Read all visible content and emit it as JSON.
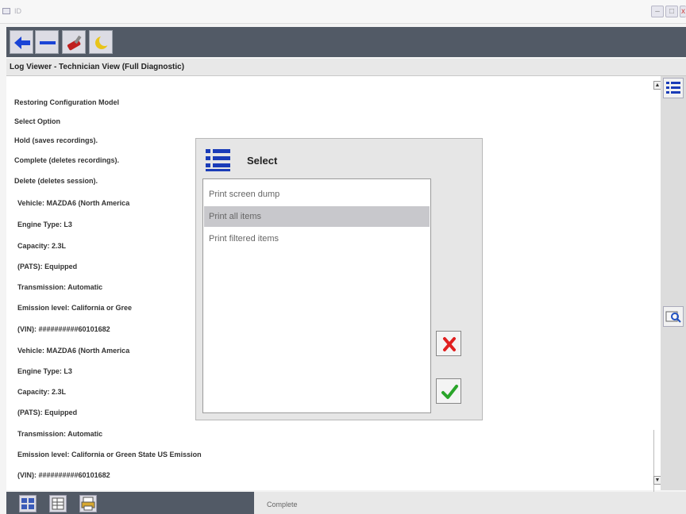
{
  "window": {
    "title": "ID"
  },
  "panel": {
    "title": "Log Viewer - Technician View (Full Diagnostic)"
  },
  "log_lines": [
    "Restoring Configuration Model",
    "Select Option",
    "Hold (saves recordings).",
    "Complete (deletes recordings).",
    "Delete (deletes session).",
    "Vehicle:  MAZDA6 (North America",
    "Engine Type:  L3",
    "Capacity:  2.3L",
    "(PATS):  Equipped",
    "Transmission:  Automatic",
    "Emission level:  California or Gree",
    "(VIN):  ##########60101682",
    "Vehicle:  MAZDA6 (North America",
    "Engine Type:  L3",
    "Capacity:  2.3L",
    "(PATS):  Equipped",
    "Transmission:  Automatic",
    "Emission level:  California or Green State US Emission",
    "(VIN):  ##########60101682"
  ],
  "dialog": {
    "title": "Select",
    "options": [
      {
        "label": "Print screen dump",
        "selected": false
      },
      {
        "label": "Print all items",
        "selected": true
      },
      {
        "label": "Print filtered items",
        "selected": false
      }
    ],
    "cancel_icon": "red-x-icon",
    "ok_icon": "green-check-icon"
  },
  "status": {
    "text": "Complete"
  },
  "colors": {
    "toolbar": "#525a66",
    "selection": "#c8c8cc",
    "cancel": "#e02020",
    "ok": "#2aa52a"
  }
}
